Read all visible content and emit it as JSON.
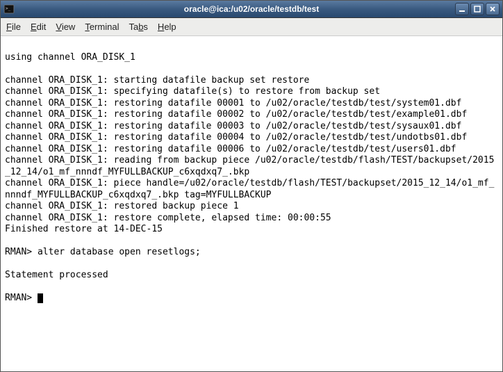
{
  "window": {
    "title": "oracle@ica:/u02/oracle/testdb/test"
  },
  "menubar": {
    "file": {
      "accel": "F",
      "rest": "ile"
    },
    "edit": {
      "accel": "E",
      "rest": "dit"
    },
    "view": {
      "accel": "V",
      "rest": "iew"
    },
    "terminal": {
      "accel": "T",
      "rest": "erminal"
    },
    "tabs": {
      "pre": "Ta",
      "accel": "b",
      "rest": "s"
    },
    "help": {
      "accel": "H",
      "rest": "elp"
    }
  },
  "terminal": {
    "lines": [
      "",
      "using channel ORA_DISK_1",
      "",
      "channel ORA_DISK_1: starting datafile backup set restore",
      "channel ORA_DISK_1: specifying datafile(s) to restore from backup set",
      "channel ORA_DISK_1: restoring datafile 00001 to /u02/oracle/testdb/test/system01.dbf",
      "channel ORA_DISK_1: restoring datafile 00002 to /u02/oracle/testdb/test/example01.dbf",
      "channel ORA_DISK_1: restoring datafile 00003 to /u02/oracle/testdb/test/sysaux01.dbf",
      "channel ORA_DISK_1: restoring datafile 00004 to /u02/oracle/testdb/test/undotbs01.dbf",
      "channel ORA_DISK_1: restoring datafile 00006 to /u02/oracle/testdb/test/users01.dbf",
      "channel ORA_DISK_1: reading from backup piece /u02/oracle/testdb/flash/TEST/backupset/2015_12_14/o1_mf_nnndf_MYFULLBACKUP_c6xqdxq7_.bkp",
      "channel ORA_DISK_1: piece handle=/u02/oracle/testdb/flash/TEST/backupset/2015_12_14/o1_mf_nnndf_MYFULLBACKUP_c6xqdxq7_.bkp tag=MYFULLBACKUP",
      "channel ORA_DISK_1: restored backup piece 1",
      "channel ORA_DISK_1: restore complete, elapsed time: 00:00:55",
      "Finished restore at 14-DEC-15",
      "",
      "RMAN> alter database open resetlogs;",
      "",
      "Statement processed",
      "",
      "RMAN> "
    ]
  }
}
